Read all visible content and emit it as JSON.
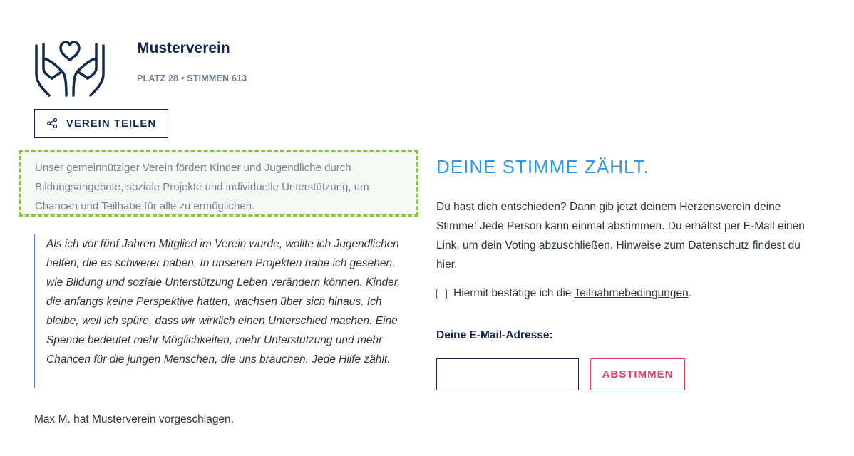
{
  "organization": {
    "name": "Musterverein",
    "meta": "PLATZ 28 • STIMMEN 613",
    "logo_icon": "heart-hands-icon"
  },
  "share": {
    "label": "VEREIN TEILEN",
    "icon": "share-icon"
  },
  "description": "Unser gemeinnütziger Verein fördert Kinder und Jugendliche durch Bildungsangebote, soziale Projekte und individuelle Unterstützung, um Chancen und Teilhabe für alle zu ermöglichen.",
  "quote": "Als ich vor fünf Jahren Mitglied im Verein wurde, wollte ich Jugendlichen helfen, die es schwerer haben. In unseren Projekten habe ich gesehen, wie Bildung und soziale Unterstützung Leben verändern können. Kinder, die anfangs keine Perspektive hatten, wachsen über sich hinaus. Ich bleibe, weil ich spüre, dass wir wirklich einen Unterschied machen. Eine Spende bedeutet mehr Möglichkeiten, mehr Unterstützung und mehr Chancen für die jungen Menschen, die uns brauchen. Jede Hilfe zählt.",
  "proposed_by": "Max M. hat Musterverein vorgeschlagen.",
  "vote": {
    "title": "DEINE STIMME ZÄHLT.",
    "text_before_link": "Du hast dich entschieden? Dann gib jetzt deinem Herzensverein deine Stimme! Jede Person kann einmal abstimmen. Du erhältst per E-Mail einen Link, um dein Voting abzuschließen. Hinweise zum Datenschutz findest du ",
    "link": "hier",
    "text_after_link": ".",
    "consent_before": "Hiermit bestätige ich die ",
    "consent_link": "Teilnahmebedingungen",
    "consent_after": ".",
    "consent_checked": false,
    "email_label": "Deine E-Mail-Adresse:",
    "email_value": "",
    "button_label": "ABSTIMMEN"
  },
  "colors": {
    "navy": "#13294b",
    "accent_blue": "#2e97e6",
    "vote_red": "#e23d64",
    "dashed_green": "#8cc63f"
  }
}
